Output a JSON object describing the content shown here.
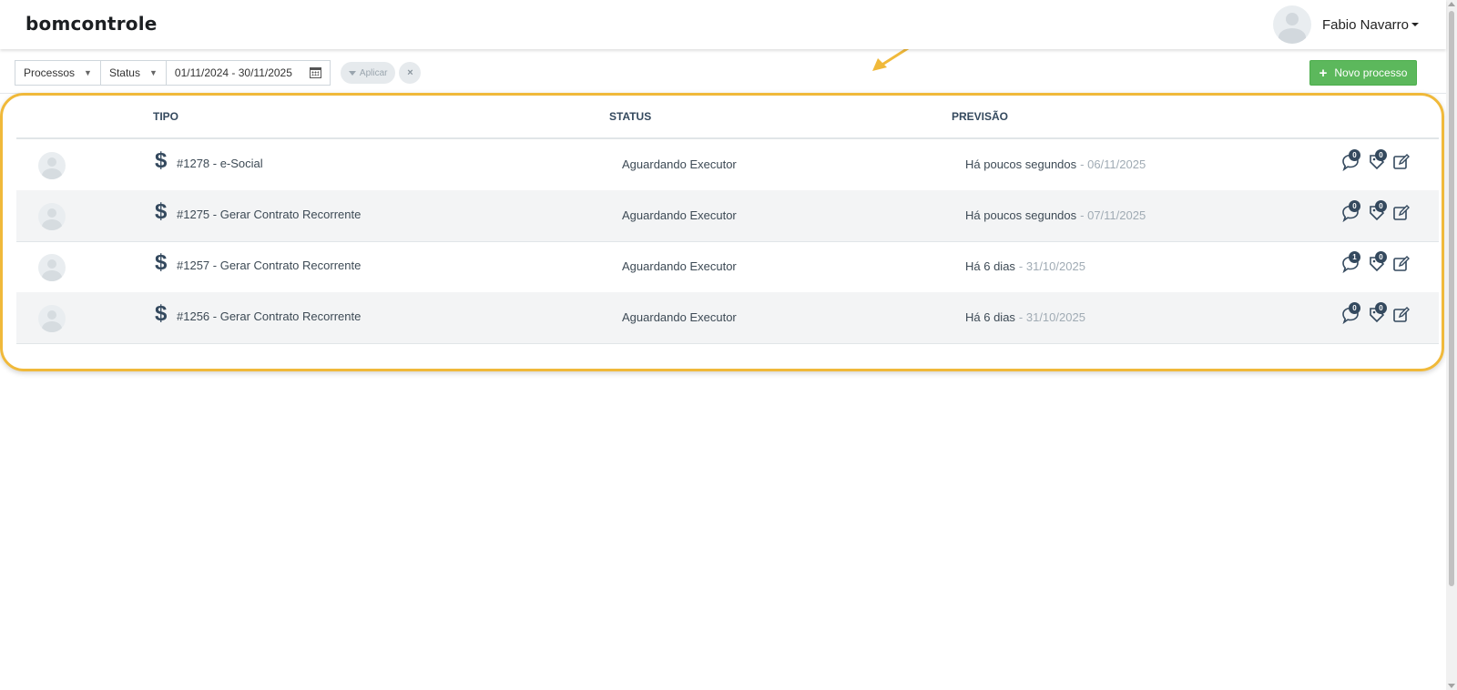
{
  "header": {
    "logo_text": "bomcontrole",
    "user_name": "Fabio Navarro"
  },
  "filters": {
    "processos_label": "Processos",
    "status_label": "Status",
    "date_range": "01/11/2024 - 30/11/2025",
    "apply_label": "Aplicar",
    "clear_label": "×"
  },
  "toolbar": {
    "new_process_label": "Novo processo"
  },
  "table": {
    "columns": [
      "TIPO",
      "STATUS",
      "PREVISÃO"
    ],
    "rows": [
      {
        "tipo": "#1278 - e-Social",
        "status": "Aguardando Executor",
        "previsao_rel": "Há poucos segundos",
        "previsao_date": "- 06/11/2025",
        "comments": "0",
        "tags": "0"
      },
      {
        "tipo": "#1275 - Gerar Contrato Recorrente",
        "status": "Aguardando Executor",
        "previsao_rel": "Há poucos segundos",
        "previsao_date": "- 07/11/2025",
        "comments": "0",
        "tags": "0"
      },
      {
        "tipo": "#1257 - Gerar Contrato Recorrente",
        "status": "Aguardando Executor",
        "previsao_rel": "Há 6 dias",
        "previsao_date": "- 31/10/2025",
        "comments": "1",
        "tags": "0"
      },
      {
        "tipo": "#1256 - Gerar Contrato Recorrente",
        "status": "Aguardando Executor",
        "previsao_rel": "Há 6 dias",
        "previsao_date": "- 31/10/2025",
        "comments": "0",
        "tags": "0"
      }
    ]
  },
  "icons": {
    "type_icon": "dollar-icon",
    "comment_icon": "comment-icon",
    "tag_icon": "tag-icon",
    "edit_icon": "edit-icon"
  },
  "colors": {
    "accent_green": "#5cb85c",
    "highlight_yellow": "#f0b93a",
    "heading_dark": "#34495e"
  }
}
